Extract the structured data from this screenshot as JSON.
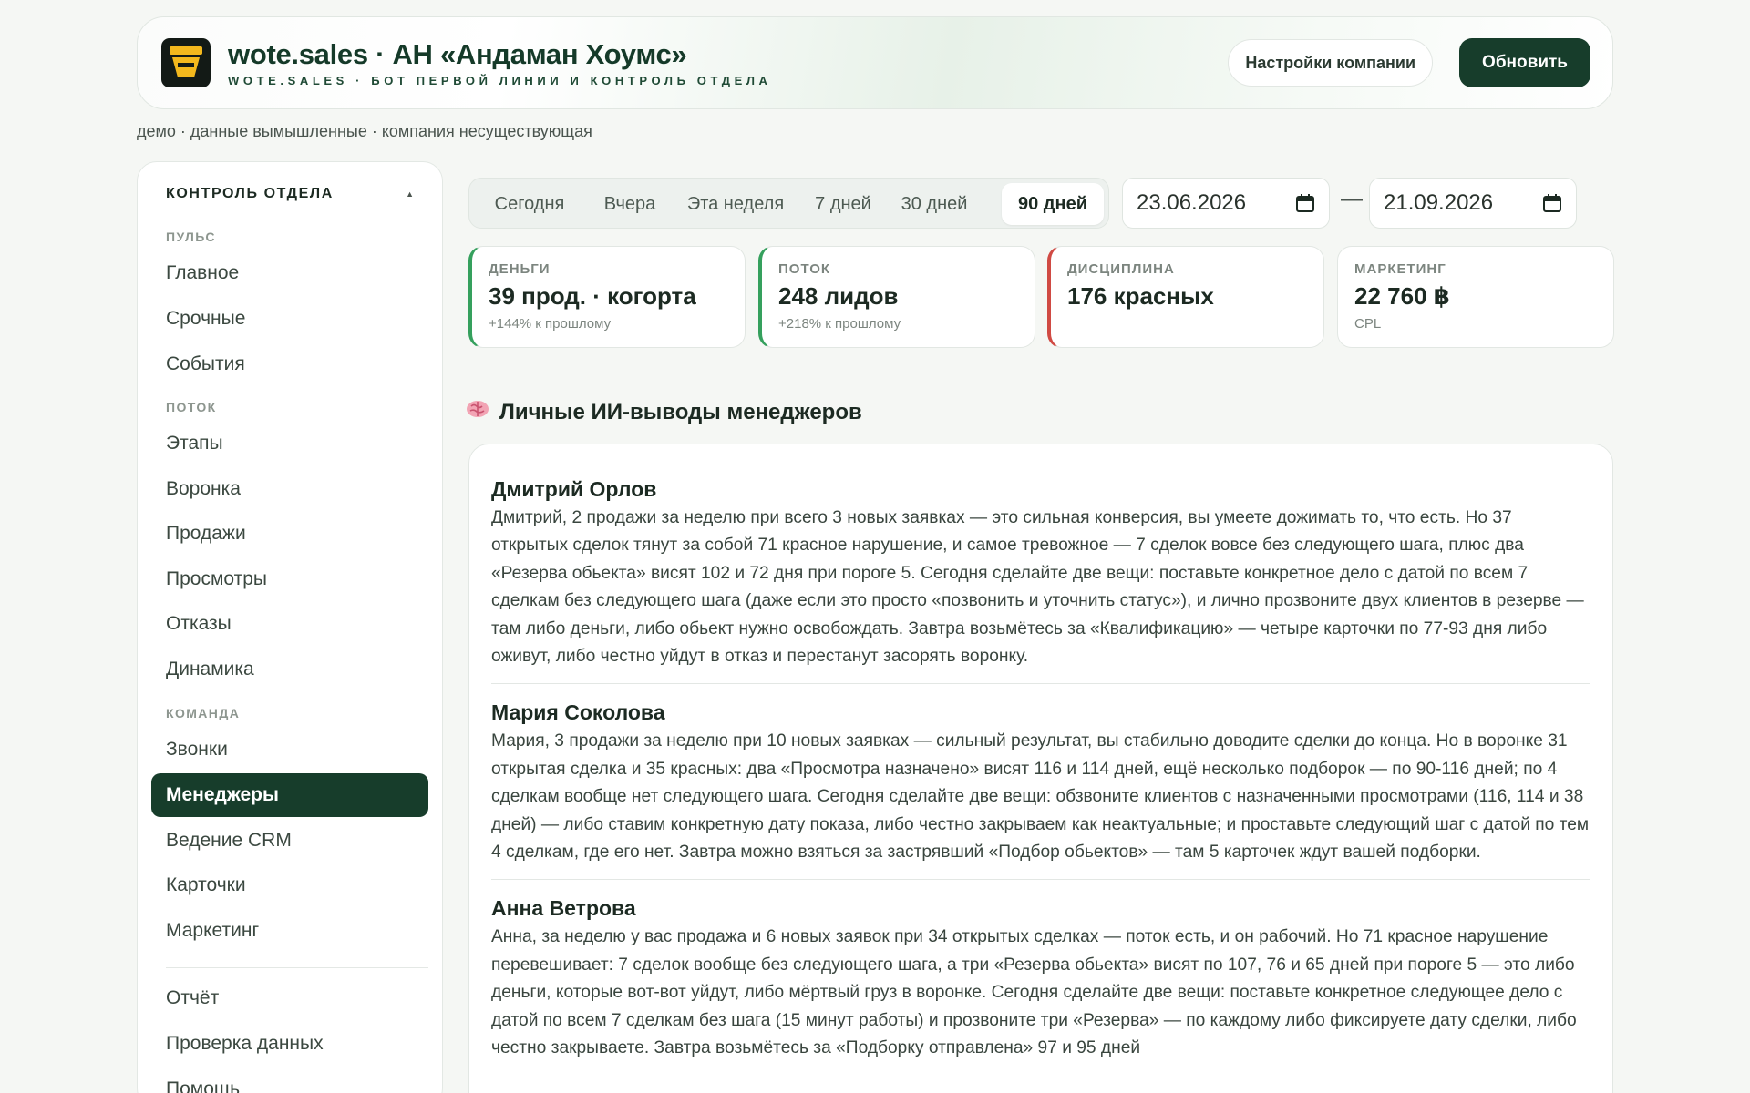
{
  "header": {
    "title": "wote.sales · АН «Андаман Хоумс»",
    "subtitle": "WOTE.SALES · БОТ ПЕРВОЙ ЛИНИИ И КОНТРОЛЬ ОТДЕЛА",
    "settings_label": "Настройки компании",
    "refresh_label": "Обновить"
  },
  "demo_note": "демо · данные вымышленные · компания несуществующая",
  "sidebar": {
    "heading": "КОНТРОЛЬ ОТДЕЛА",
    "caret": "▲",
    "sections": [
      "ПУЛЬС",
      "ПОТОК",
      "КОМАНДА"
    ],
    "items": [
      "Главное",
      "Срочные",
      "События",
      "Этапы",
      "Воронка",
      "Продажи",
      "Просмотры",
      "Отказы",
      "Динамика",
      "Звонки",
      "Менеджеры",
      "Ведение CRM",
      "Карточки",
      "Маркетинг",
      "Отчёт",
      "Проверка данных",
      "Помощь"
    ],
    "active_item": "Менеджеры"
  },
  "period": {
    "tabs": [
      "Сегодня",
      "Вчера",
      "Эта неделя",
      "7 дней",
      "30 дней",
      "90 дней"
    ],
    "active": "90 дней",
    "date_from": "23.06.2026",
    "date_to": "21.09.2026",
    "separator": "—"
  },
  "kpis": [
    {
      "label": "ДЕНЬГИ",
      "value": "39 прод. · когорта",
      "sub": "+144% к прошлому",
      "accent": "#35a05d"
    },
    {
      "label": "ПОТОК",
      "value": "248 лидов",
      "sub": "+218% к прошлому",
      "accent": "#35a05d"
    },
    {
      "label": "ДИСЦИПЛИНА",
      "value": "176 красных",
      "sub": "",
      "accent": "#d04a43"
    },
    {
      "label": "МАРКЕТИНГ",
      "value": "22 760 ฿",
      "sub": "CPL",
      "accent": ""
    }
  ],
  "section": {
    "icon": "brain-icon",
    "title": "Личные ИИ-выводы менеджеров"
  },
  "managers": [
    {
      "name": "Дмитрий Орлов",
      "text": "Дмитрий, 2 продажи за неделю при всего 3 новых заявках — это сильная конверсия, вы умеете дожимать то, что есть. Но 37 открытых сделок тянут за собой 71 красное нарушение, и самое тревожное — 7 сделок вовсе без следующего шага, плюс два «Резерва обьекта» висят 102 и 72 дня при пороге 5. Сегодня сделайте две вещи: поставьте конкретное дело с датой по всем 7 сделкам без следующего шага (даже если это просто «позвонить и уточнить статус»), и лично прозвоните двух клиентов в резерве — там либо деньги, либо обьект нужно освобождать. Завтра возьмётесь за «Квалификацию» — четыре карточки по 77-93 дня либо оживут, либо честно уйдут в отказ и перестанут засорять воронку."
    },
    {
      "name": "Мария Соколова",
      "text": "Мария, 3 продажи за неделю при 10 новых заявках — сильный результат, вы стабильно доводите сделки до конца. Но в воронке 31 открытая сделка и 35 красных: два «Просмотра назначено» висят 116 и 114 дней, ещё несколько подборок — по 90-116 дней; по 4 сделкам вообще нет следующего шага. Сегодня сделайте две вещи: обзвоните клиентов с назначенными просмотрами (116, 114 и 38 дней) — либо ставим конкретную дату показа, либо честно закрываем как неактуальные; и проставьте следующий шаг с датой по тем 4 сделкам, где его нет. Завтра можно взяться за застрявший «Подбор обьектов» — там 5 карточек ждут вашей подборки."
    },
    {
      "name": "Анна Ветрова",
      "text": "Анна, за неделю у вас продажа и 6 новых заявок при 34 открытых сделках — поток есть, и он рабочий. Но 71 красное нарушение перевешивает: 7 сделок вообще без следующего шага, а три «Резерва обьекта» висят по 107, 76 и 65 дней при пороге 5 — это либо деньги, которые вот-вот уйдут, либо мёртвый груз в воронке. Сегодня сделайте две вещи: поставьте конкретное следующее дело с датой по всем 7 сделкам без шага (15 минут работы) и прозвоните три «Резерва» — по каждому либо фиксируете дату сделки, либо честно закрываете. Завтра возьмётесь за «Подборку отправлена» 97 и 95 дней"
    }
  ]
}
